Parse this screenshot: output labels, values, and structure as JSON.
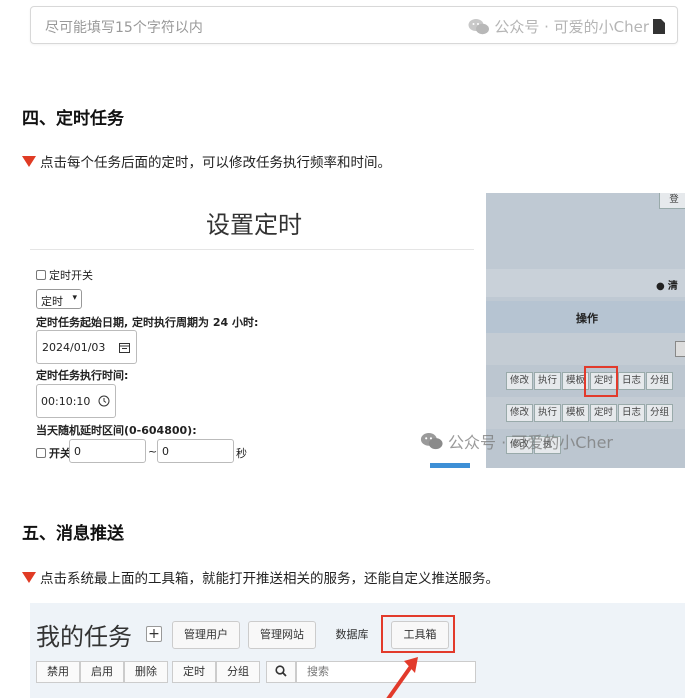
{
  "top_input": {
    "placeholder": "尽可能填写15个字符以内",
    "watermark": "公众号 · 可爱的小Cher"
  },
  "section4": {
    "heading": "四、定时任务",
    "desc": "点击每个任务后面的定时，可以修改任务执行频率和时间。"
  },
  "timer_dialog": {
    "title": "设置定时",
    "switch_label": "定时开关",
    "mode_select": "定时",
    "start_label": "定时任务起始日期, 定时执行周期为 24 小时:",
    "start_date": "2024/01/03",
    "time_label": "定时任务执行时间:",
    "time_value": "00:10:10",
    "delay_label": "当天随机延时区间(0-604800):",
    "delay_switch": "开关",
    "delay_from": "0",
    "delay_sep": "~",
    "delay_to": "0",
    "delay_unit": "秒"
  },
  "background_page": {
    "login_btn": "登",
    "clear_btn": "清",
    "ops_header": "操作",
    "row_buttons": [
      "修改",
      "执行",
      "模板",
      "定时",
      "日志",
      "分组"
    ],
    "row3_partial": [
      "修改",
      "执"
    ]
  },
  "watermark": "公众号 · 可爱的小Cher",
  "section5": {
    "heading": "五、消息推送",
    "desc": "点击系统最上面的工具箱，就能打开推送相关的服务，还能自定义推送服务。"
  },
  "task_page": {
    "title": "我的任务",
    "add": "+",
    "nav": [
      "管理用户",
      "管理网站",
      "数据库",
      "工具箱"
    ],
    "actions": [
      "禁用",
      "启用",
      "删除",
      "定时",
      "分组"
    ],
    "search_placeholder": "搜索"
  },
  "colors": {
    "accent_red": "#e23a2b",
    "overlay": "#bfc9d3"
  }
}
